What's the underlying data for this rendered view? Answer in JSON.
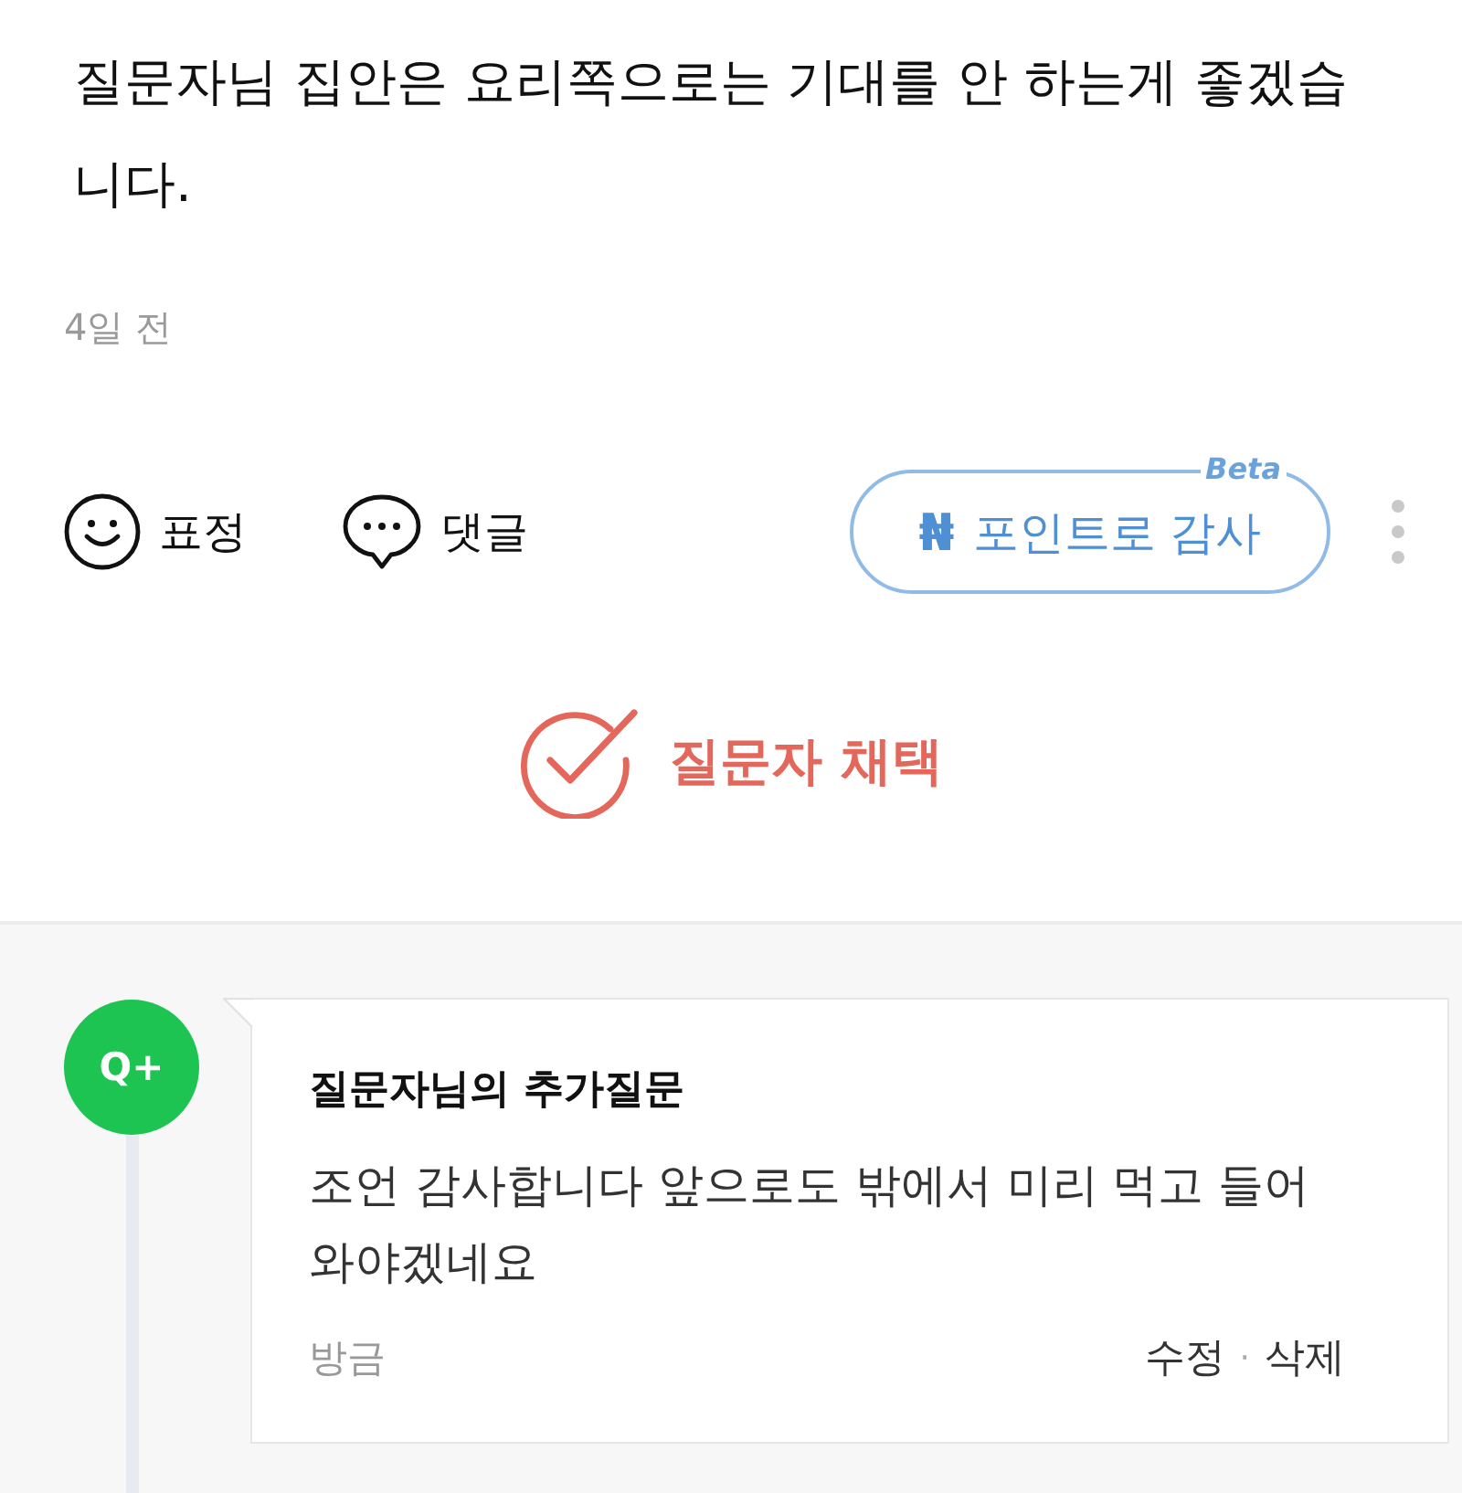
{
  "answer": {
    "text": "질문자님 집안은 요리쪽으로는 기대를 안 하는게 좋겠습니다.",
    "time": "4일 전"
  },
  "actions": [
    {
      "kind": "emotion",
      "label": "표정"
    },
    {
      "kind": "comment",
      "label": "댓글"
    }
  ],
  "thanks_button": {
    "icon": "₦",
    "label": "포인트로 감사",
    "badge": "Beta"
  },
  "adopt_button": {
    "label": "질문자 채택"
  },
  "additional_question": {
    "badge": "Q+",
    "title": "질문자님의 추가질문",
    "text": "조언 감사합니다 앞으로도 밖에서 미리 먹고 들어와야겠네요",
    "time": "방금",
    "links": [
      "수정",
      "삭제"
    ],
    "separator": "·"
  }
}
